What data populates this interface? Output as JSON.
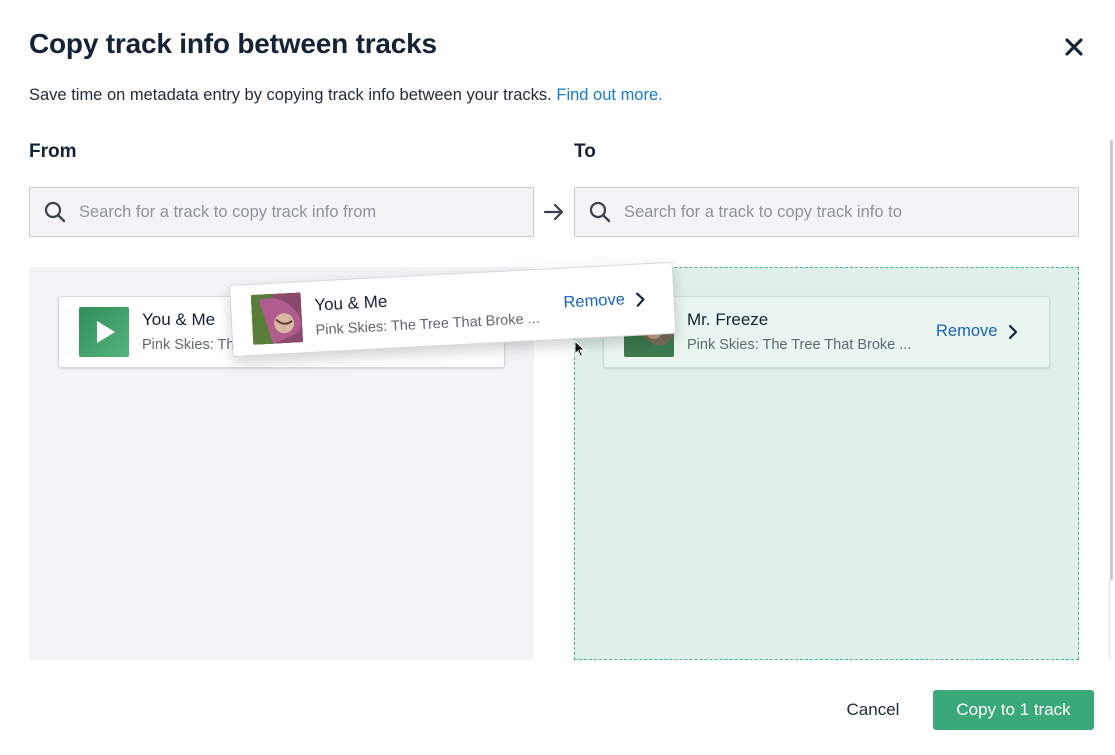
{
  "dialog": {
    "title": "Copy track info between tracks",
    "subtitle": "Save time on metadata entry by copying track info between your tracks.",
    "link": "Find out more.",
    "icons": {
      "close": "close-icon",
      "arrow": "arrow-right-icon",
      "search": "search-icon",
      "chevron": "chevron-right-icon",
      "play": "play-icon"
    }
  },
  "from": {
    "label": "From",
    "search_placeholder": "Search for a track to copy track info from",
    "track": {
      "title": "You & Me",
      "subtitle": "Pink Skies: The Tree That Broke ..."
    }
  },
  "to": {
    "label": "To",
    "search_placeholder": "Search for a track to copy track info to",
    "track": {
      "title": "Mr. Freeze",
      "subtitle": "Pink Skies: The Tree That Broke ...",
      "remove": "Remove"
    }
  },
  "dragging": {
    "title": "You & Me",
    "subtitle": "Pink Skies: The Tree That Broke ...",
    "remove": "Remove"
  },
  "footer": {
    "cancel": "Cancel",
    "copy": "Copy to 1 track"
  },
  "colors": {
    "primary": "#3aa878",
    "link": "#1a7bc8",
    "drop_zone": "#e0efea"
  }
}
